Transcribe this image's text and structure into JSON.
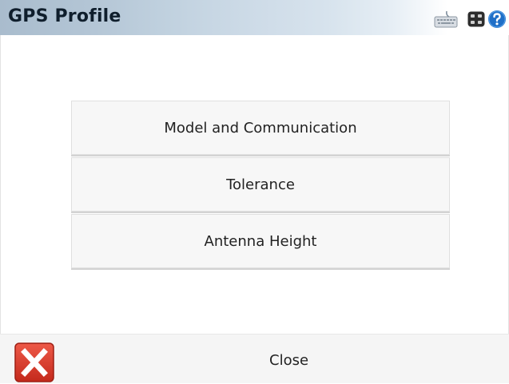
{
  "window": {
    "title": "GPS Profile"
  },
  "toolbar_icons": [
    "keyboard-icon",
    "app-switch-icon",
    "help-icon"
  ],
  "menu": {
    "items": [
      {
        "label": "Model and Communication"
      },
      {
        "label": "Tolerance"
      },
      {
        "label": "Antenna Height"
      }
    ]
  },
  "footer": {
    "close_label": "Close",
    "close_icon": "red-x-icon"
  },
  "colors": {
    "close_red": "#d93a2b",
    "help_blue": "#1f6fc7"
  }
}
